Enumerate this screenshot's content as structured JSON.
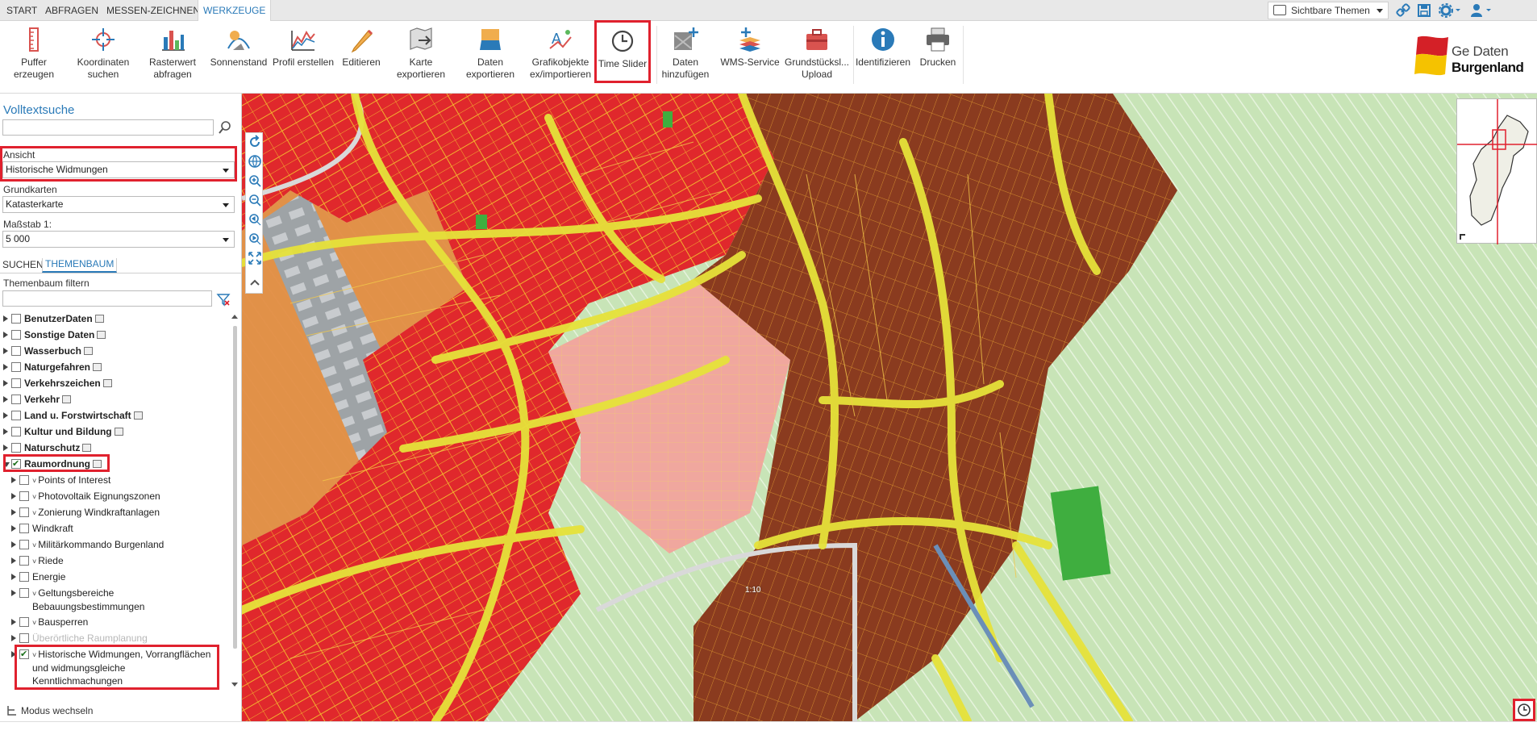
{
  "menu": {
    "tabs": [
      {
        "label": "START"
      },
      {
        "label": "ABFRAGEN"
      },
      {
        "label": "MESSEN-ZEICHNEN"
      },
      {
        "label": "WERKZEUGE",
        "active": true
      }
    ],
    "themes_select": "Sichtbare Themen"
  },
  "ribbon": {
    "tools": [
      {
        "line1": "Puffer",
        "line2": "erzeugen",
        "icon": "ruler-red-icon"
      },
      {
        "line1": "Koordinaten",
        "line2": "suchen",
        "icon": "crosshair-icon"
      },
      {
        "line1": "Rasterwert",
        "line2": "abfragen",
        "icon": "bar-chart-icon"
      },
      {
        "line1": "Sonnenstand",
        "line2": "",
        "icon": "sun-position-icon"
      },
      {
        "line1": "Profil erstellen",
        "line2": "",
        "icon": "profile-chart-icon"
      },
      {
        "line1": "Editieren",
        "line2": "",
        "icon": "pencil-icon"
      },
      {
        "line1": "Karte",
        "line2": "exportieren",
        "icon": "map-export-icon"
      },
      {
        "line1": "Daten",
        "line2": "exportieren",
        "icon": "data-export-icon"
      },
      {
        "line1": "Grafikobjekte",
        "line2": "ex/importieren",
        "icon": "graphics-ie-icon"
      },
      {
        "line1": "Time Slider",
        "line2": "",
        "icon": "clock-icon"
      },
      {
        "line1": "Daten",
        "line2": "hinzufügen",
        "icon": "add-data-icon"
      },
      {
        "line1": "WMS-Service",
        "line2": "",
        "icon": "wms-icon"
      },
      {
        "line1": "Grundstücksl...",
        "line2": "Upload",
        "icon": "briefcase-icon"
      },
      {
        "line1": "Identifizieren",
        "line2": "",
        "icon": "info-icon"
      },
      {
        "line1": "Drucken",
        "line2": "",
        "icon": "printer-icon"
      }
    ],
    "logo": {
      "line1": "Ge Daten",
      "line2": "Burgenland"
    }
  },
  "panel": {
    "search_title": "Volltextsuche",
    "search_value": "",
    "ansicht_label": "Ansicht",
    "ansicht_value": "Historische Widmungen",
    "grundkarten_label": "Grundkarten",
    "grundkarten_value": "Katasterkarte",
    "massstab_label": "Maßstab 1:",
    "massstab_value": "5 000",
    "tab_suchen": "SUCHEN",
    "tab_themenbaum": "THEMENBAUM",
    "filter_label": "Themenbaum filtern",
    "filter_value": "",
    "mode_switch": "Modus wechseln"
  },
  "tree": [
    {
      "label": "BenutzerDaten",
      "bold": true,
      "level": 0,
      "checked": false,
      "meta": true
    },
    {
      "label": "Sonstige Daten",
      "bold": true,
      "level": 0,
      "checked": false,
      "meta": true
    },
    {
      "label": "Wasserbuch",
      "bold": true,
      "level": 0,
      "checked": false,
      "meta": true
    },
    {
      "label": "Naturgefahren",
      "bold": true,
      "level": 0,
      "checked": false,
      "meta": true
    },
    {
      "label": "Verkehrszeichen",
      "bold": true,
      "level": 0,
      "checked": false,
      "meta": true
    },
    {
      "label": "Verkehr",
      "bold": true,
      "level": 0,
      "checked": false,
      "meta": true
    },
    {
      "label": "Land u. Forstwirtschaft",
      "bold": true,
      "level": 0,
      "checked": false,
      "meta": true
    },
    {
      "label": "Kultur und Bildung",
      "bold": true,
      "level": 0,
      "checked": false,
      "meta": true
    },
    {
      "label": "Naturschutz",
      "bold": true,
      "level": 0,
      "checked": false,
      "meta": true
    },
    {
      "label": "Raumordnung",
      "bold": true,
      "level": 0,
      "checked": true,
      "meta": true,
      "open": true
    },
    {
      "label": "Points of Interest",
      "bold": false,
      "level": 1,
      "checked": false,
      "chev": true
    },
    {
      "label": "Photovoltaik Eignungszonen",
      "bold": false,
      "level": 1,
      "checked": false,
      "chev": true
    },
    {
      "label": "Zonierung Windkraftanlagen",
      "bold": false,
      "level": 1,
      "checked": false,
      "chev": true
    },
    {
      "label": "Windkraft",
      "bold": false,
      "level": 1,
      "checked": false
    },
    {
      "label": "Militärkommando Burgenland",
      "bold": false,
      "level": 1,
      "checked": false,
      "chev": true
    },
    {
      "label": "Riede",
      "bold": false,
      "level": 1,
      "checked": false,
      "chev": true
    },
    {
      "label": "Energie",
      "bold": false,
      "level": 1,
      "checked": false
    },
    {
      "label": "Geltungsbereiche",
      "label2": "Bebauungsbestimmungen",
      "bold": false,
      "level": 1,
      "checked": false,
      "chev": true
    },
    {
      "label": "Bausperren",
      "bold": false,
      "level": 1,
      "checked": false,
      "chev": true
    },
    {
      "label": "Überörtliche Raumplanung",
      "bold": false,
      "level": 1,
      "checked": false,
      "grey": true
    },
    {
      "label": "Historische Widmungen, Vorrangflächen",
      "label2": "und widmungsgleiche",
      "label3": "Kenntlichmachungen",
      "bold": false,
      "level": 1,
      "checked": true,
      "chev": true
    }
  ],
  "map": {
    "scale_label": "1:10"
  },
  "colors": {
    "accent": "#2a7ab8",
    "highlight": "#e0212e",
    "zone_red": "#e8282c",
    "zone_brown": "#8b3a1e",
    "zone_pink": "#f2a7a0",
    "zone_orange": "#e8893a",
    "zone_green": "#b7dca2",
    "road_yellow": "#e8e23a"
  }
}
